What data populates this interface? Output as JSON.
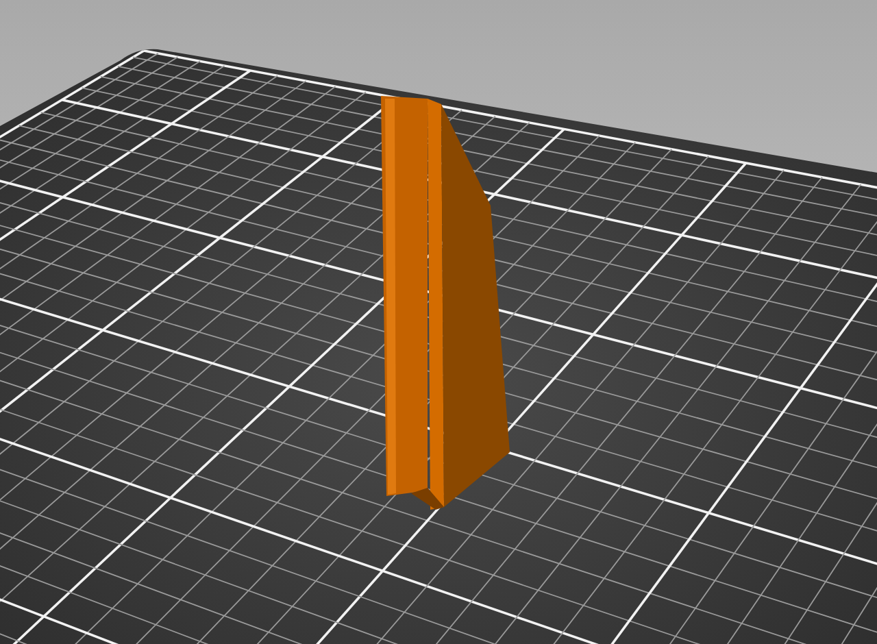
{
  "viewport": {
    "kind": "build-plate"
  }
}
